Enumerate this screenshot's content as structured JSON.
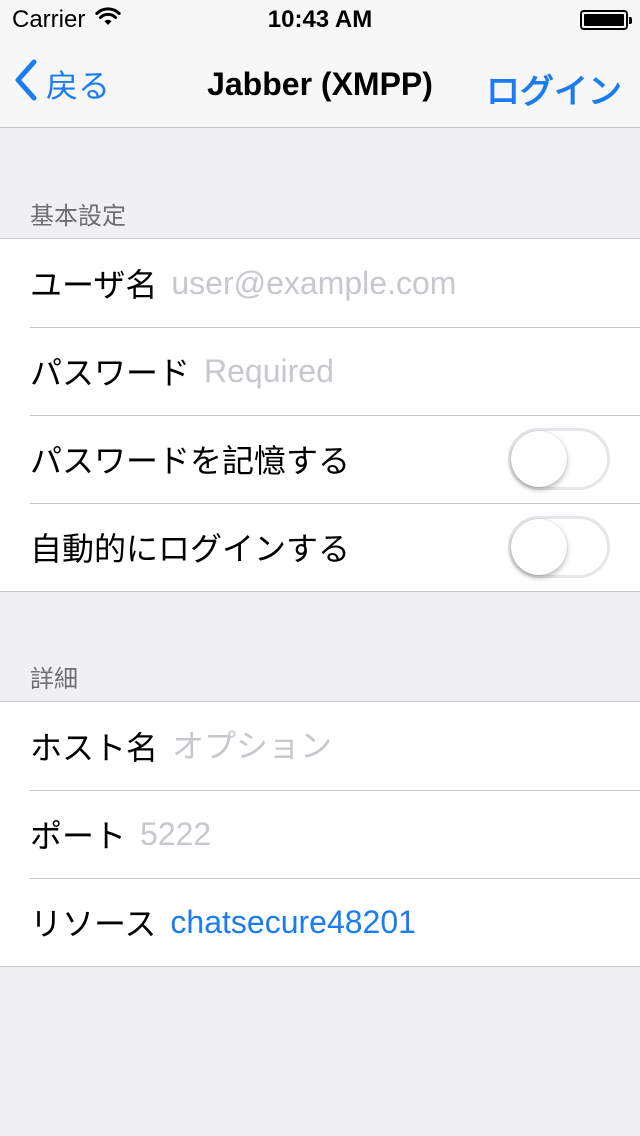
{
  "status_bar": {
    "carrier": "Carrier",
    "time": "10:43 AM"
  },
  "nav": {
    "back_label": "戻る",
    "title": "Jabber (XMPP)",
    "login_label": "ログイン"
  },
  "basic": {
    "header": "基本設定",
    "username_label": "ユーザ名",
    "username_placeholder": "user@example.com",
    "password_label": "パスワード",
    "password_placeholder": "Required",
    "remember_label": "パスワードを記憶する",
    "remember_on": false,
    "autologin_label": "自動的にログインする",
    "autologin_on": false
  },
  "details": {
    "header": "詳細",
    "host_label": "ホスト名",
    "host_placeholder": "オプション",
    "port_label": "ポート",
    "port_placeholder": "5222",
    "resource_label": "リソース",
    "resource_value": "chatsecure48201"
  },
  "colors": {
    "accent": "#1b7cf2",
    "background": "#efeff4",
    "separator": "#c8c7cc"
  }
}
